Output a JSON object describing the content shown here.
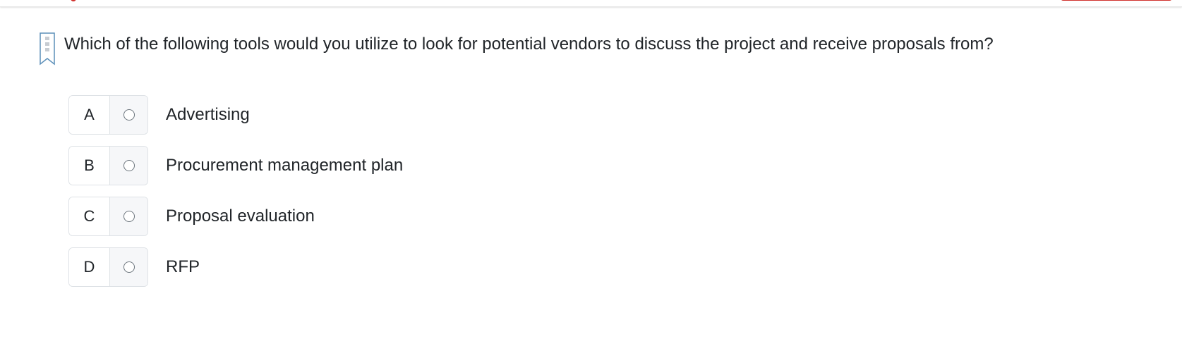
{
  "question": {
    "text": "Which of the following tools would you utilize to look for potential vendors to discuss the project and receive proposals from?",
    "bookmark_icon": "bookmark-icon"
  },
  "options": [
    {
      "letter": "A",
      "label": "Advertising",
      "selected": false
    },
    {
      "letter": "B",
      "label": "Procurement management plan",
      "selected": false
    },
    {
      "letter": "C",
      "label": "Proposal evaluation",
      "selected": false
    },
    {
      "letter": "D",
      "label": "RFP",
      "selected": false
    }
  ],
  "colors": {
    "accent": "#d0312d",
    "bookmark": "#5b8fb9",
    "border": "#dee2e6",
    "radio_cell_bg": "#f6f7f9"
  }
}
